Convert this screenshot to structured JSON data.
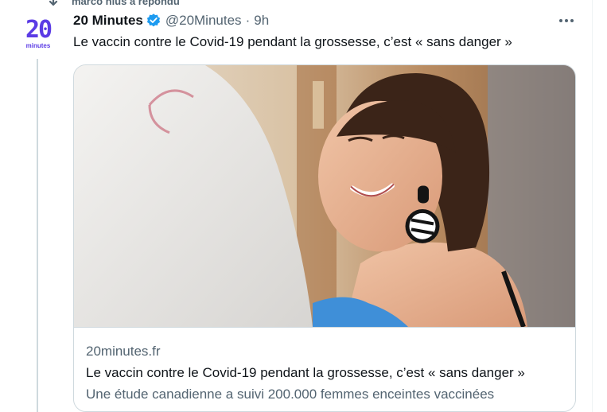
{
  "social_context": {
    "text": "marco nius a répondu"
  },
  "tweet": {
    "avatar": {
      "big": "20",
      "small": "minutes"
    },
    "author_name": "20 Minutes",
    "handle": "@20Minutes",
    "separator": "·",
    "time": "9h",
    "text": "Le vaccin contre le Covid-19 pendant la grossesse, c’est « sans danger »",
    "verified_icon": "verified-badge-icon",
    "more_icon": "more-horizontal-icon"
  },
  "card": {
    "domain": "20minutes.fr",
    "title": "Le vaccin contre le Covid-19 pendant la grossesse, c’est « sans danger »",
    "description": "Une étude canadienne a suivi 200.000 femmes enceintes vaccinées"
  },
  "colors": {
    "accent": "#1d9bf0",
    "secondary_text": "#536471",
    "brand_20minutes": "#5b3be5",
    "border": "#cfd9de"
  }
}
